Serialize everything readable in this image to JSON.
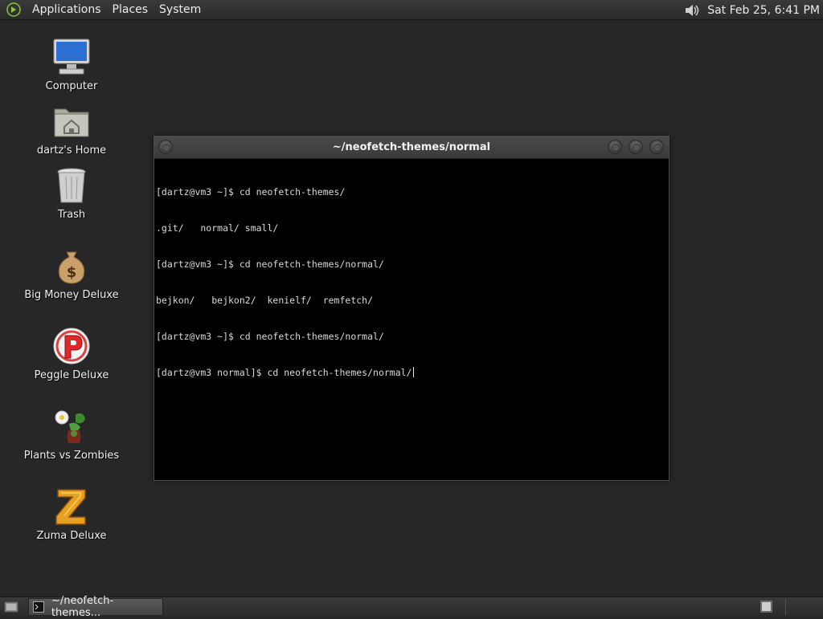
{
  "top_panel": {
    "menus": [
      "Applications",
      "Places",
      "System"
    ],
    "logo_icon": "gnome-foot-icon",
    "sound_icon": "speaker-volume-icon",
    "clock": "Sat Feb 25, 6:41 PM"
  },
  "desktop_icons": [
    {
      "label": "Computer",
      "icon": "computer-icon"
    },
    {
      "label": "dartz's Home",
      "icon": "home-folder-icon"
    },
    {
      "label": "Trash",
      "icon": "trash-icon"
    },
    {
      "label": "Big Money Deluxe",
      "icon": "money-bag-icon"
    },
    {
      "label": "Peggle Deluxe",
      "icon": "peggle-icon"
    },
    {
      "label": "Plants vs Zombies",
      "icon": "plants-vs-zombies-icon"
    },
    {
      "label": "Zuma Deluxe",
      "icon": "zuma-icon"
    }
  ],
  "terminal": {
    "title": "~/neofetch-themes/normal",
    "lines": [
      "[dartz@vm3 ~]$ cd neofetch-themes/",
      ".git/   normal/ small/",
      "[dartz@vm3 ~]$ cd neofetch-themes/normal/",
      "bejkon/   bejkon2/  kenielf/  remfetch/",
      "[dartz@vm3 ~]$ cd neofetch-themes/normal/",
      "[dartz@vm3 normal]$ cd neofetch-themes/normal/"
    ]
  },
  "taskbar": {
    "task_label": "~/neofetch-themes...",
    "task_icon": "terminal-icon",
    "show_desktop_icon": "show-desktop-icon"
  },
  "colors": {
    "desktop_bg": "#272727",
    "terminal_bg": "#000000",
    "panel_bg": "#333333"
  }
}
